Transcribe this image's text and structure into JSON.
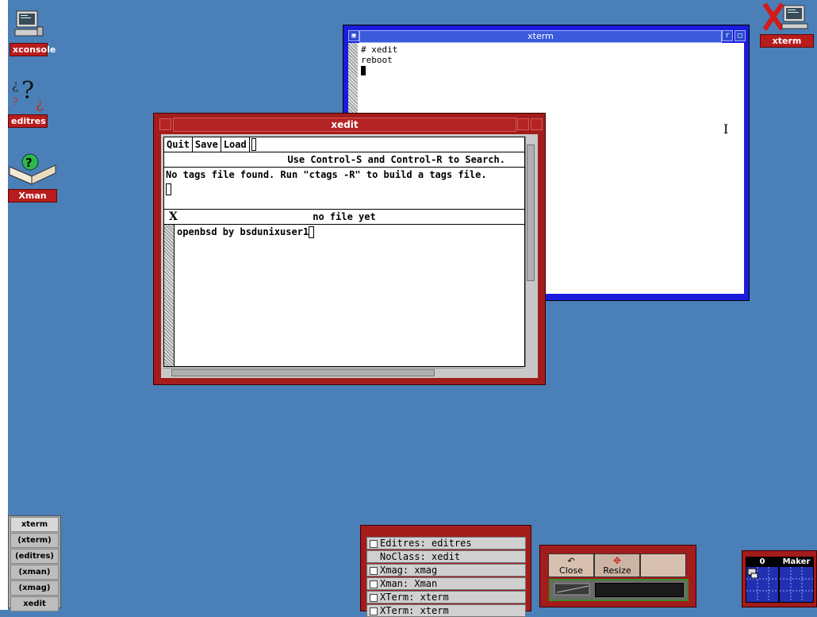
{
  "desktop_icons": [
    {
      "label": "xconsole",
      "icon": "terminal-icon"
    },
    {
      "label": "editres",
      "icon": "question-icon"
    },
    {
      "label": "Xman",
      "icon": "book-icon"
    },
    {
      "label": "xterm",
      "icon": "xterm-icon"
    }
  ],
  "xterm": {
    "title": "xterm",
    "lines": [
      "# xedit",
      "reboot"
    ]
  },
  "xedit": {
    "title": "xedit",
    "buttons": [
      "Quit",
      "Save",
      "Load"
    ],
    "message": "Use Control-S and Control-R to Search.",
    "info": "No tags file found. Run \"ctags -R\" to build a tags file.",
    "file_mark": "X",
    "file_status": "no file yet",
    "content": "openbsd by bsdunixuser1"
  },
  "iconmanager": {
    "items": [
      "xterm",
      "(xterm)",
      "(editres)",
      "(xman)",
      "(xmag)",
      "xedit"
    ]
  },
  "window_list": {
    "items": [
      "Editres: editres",
      "NoClass: xedit",
      "Xmag: xmag",
      "Xman: Xman",
      "XTerm: xterm",
      "XTerm: xterm"
    ]
  },
  "button_box": {
    "close": "Close",
    "resize": "Resize"
  },
  "pager": {
    "desks": [
      "0",
      "Maker"
    ]
  }
}
